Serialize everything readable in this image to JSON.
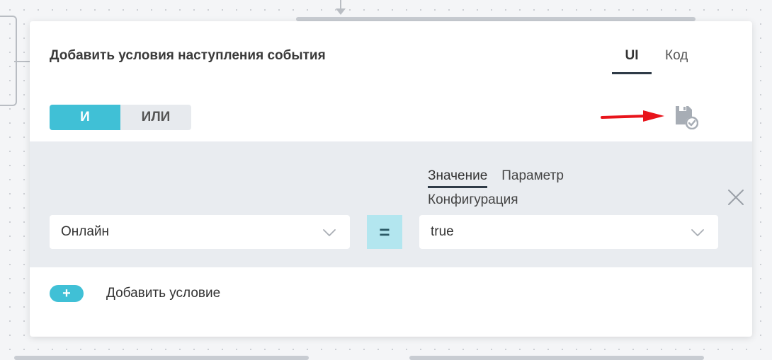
{
  "panel": {
    "title": "Добавить условия наступления события",
    "mode_tabs": {
      "ui": "UI",
      "code": "Код",
      "active": "ui"
    }
  },
  "logic_toggle": {
    "and_label": "И",
    "or_label": "ИЛИ",
    "selected": "and"
  },
  "condition": {
    "field_value": "Онлайн",
    "operator": "=",
    "value_type_tabs": {
      "value": "Значение",
      "parameter": "Параметр",
      "configuration": "Конфигурация",
      "active": "value"
    },
    "value": "true"
  },
  "add_condition": {
    "button_symbol": "+",
    "label": "Добавить условие"
  },
  "icons": {
    "save": "save-check-icon",
    "remove": "close-icon",
    "dropdown": "chevron-down-icon",
    "annotation": "red-arrow-icon"
  },
  "colors": {
    "accent": "#40c0d6",
    "operator_bg": "#b3e6ef",
    "condition_bg": "#e9ecf0",
    "annotation": "#e8141b"
  }
}
